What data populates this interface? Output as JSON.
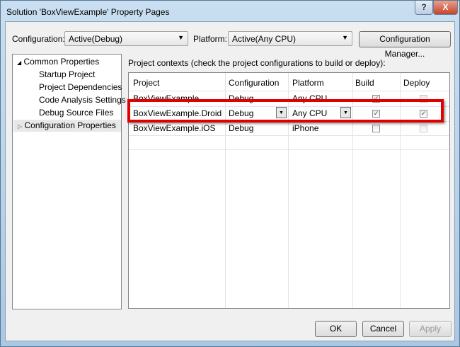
{
  "window": {
    "title": "Solution 'BoxViewExample' Property Pages",
    "help": "?",
    "close": "X"
  },
  "toolbar": {
    "configuration_label": "Configuration:",
    "configuration_value": "Active(Debug)",
    "platform_label": "Platform:",
    "platform_value": "Active(Any CPU)",
    "config_manager": "Configuration Manager..."
  },
  "tree": {
    "common": "Common Properties",
    "items": [
      "Startup Project",
      "Project Dependencies",
      "Code Analysis Settings",
      "Debug Source Files"
    ],
    "config": "Configuration Properties"
  },
  "contexts_label": "Project contexts (check the project configurations to build or deploy):",
  "grid": {
    "headers": [
      "Project",
      "Configuration",
      "Platform",
      "Build",
      "Deploy"
    ],
    "rows": [
      {
        "project": "BoxViewExample",
        "configuration": "Debug",
        "platform": "Any CPU",
        "build": true,
        "deploy": false
      },
      {
        "project": "BoxViewExample.Droid",
        "configuration": "Debug",
        "platform": "Any CPU",
        "build": true,
        "deploy": true
      },
      {
        "project": "BoxViewExample.iOS",
        "configuration": "Debug",
        "platform": "iPhone",
        "build": false,
        "deploy": false
      }
    ]
  },
  "buttons": {
    "ok": "OK",
    "cancel": "Cancel",
    "apply": "Apply"
  },
  "highlight_color": "#e00000"
}
